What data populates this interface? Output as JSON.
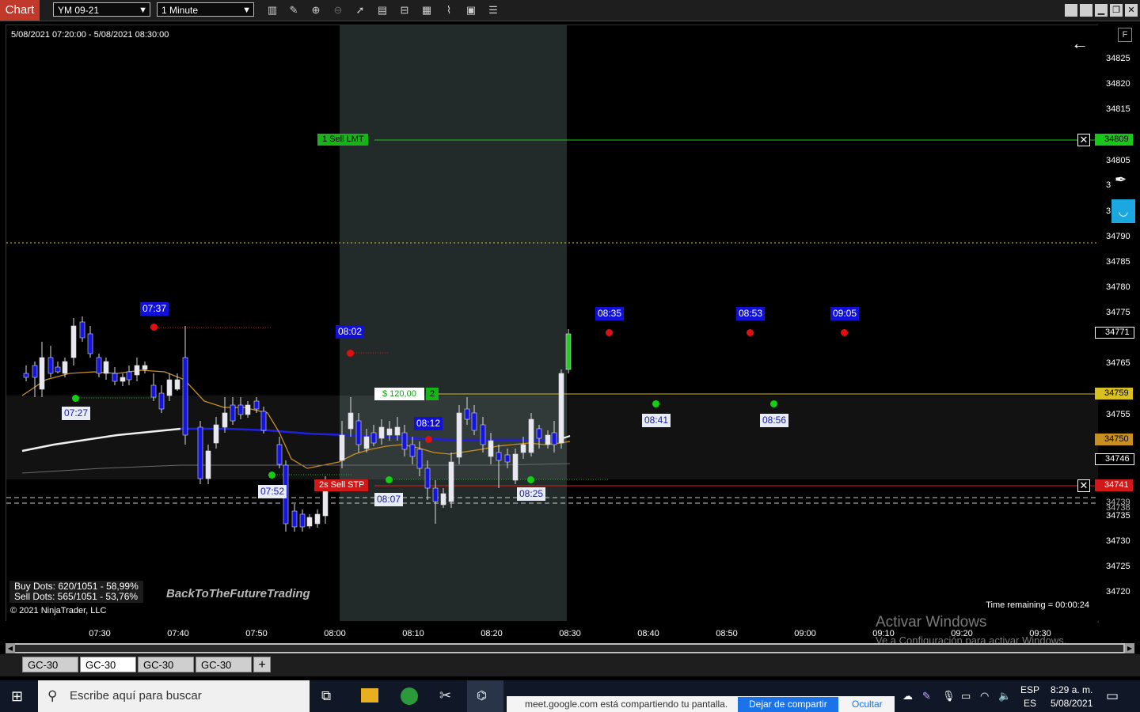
{
  "toolbar": {
    "title": "Chart",
    "instrument": "YM 09-21",
    "interval": "1 Minute"
  },
  "chart": {
    "date_range": "5/08/2021 07:20:00 - 5/08/2021 08:30:00",
    "y_ticks": [
      "34825",
      "34820",
      "34815",
      "34805",
      "34790",
      "34785",
      "34780",
      "34775",
      "34765",
      "34755",
      "34735",
      "34730",
      "34725",
      "34720"
    ],
    "x_ticks": [
      "07:30",
      "07:40",
      "07:50",
      "08:00",
      "08:10",
      "08:20",
      "08:30",
      "08:40",
      "08:50",
      "09:00",
      "09:10",
      "09:20",
      "09:30"
    ],
    "partial_ticks": {
      "a": "3",
      "b": "3"
    },
    "price_tags": {
      "sell_lmt": "34809",
      "last": "34771",
      "position": "34759",
      "vwap": "34750",
      "low_ref": "34746",
      "sell_stp": "34741",
      "dash1": "34739",
      "dash2": "34738"
    },
    "orders": {
      "sell_lmt_label": "1  Sell LMT",
      "sell_stp_label": "2s  Sell STP",
      "pnl": "$ 120,00",
      "pnl_qty": "2"
    },
    "time_tags": {
      "t0737": "07:37",
      "t0727": "07:27",
      "t0802": "08:02",
      "t0752": "07:52",
      "t0807": "08:07",
      "t0812": "08:12",
      "t0825": "08:25",
      "t0835": "08:35",
      "t0841": "08:41",
      "t0853": "08:53",
      "t0856": "08:56",
      "t0905": "09:05"
    },
    "stats": {
      "buy_dots": "Buy Dots: 620/1051 - 58,99%",
      "sell_dots": "Sell Dots: 565/1051 - 53,76%"
    },
    "watermark": "BackToTheFutureTrading",
    "copyright": "© 2021 NinjaTrader, LLC",
    "time_remaining": "Time remaining = 00:00:24",
    "colors": {
      "up": "#e8e8f0",
      "down": "#1414e0",
      "buy": "#16b416",
      "sell": "#d01818",
      "vwap": "#c89020",
      "session_shade": "#232b2a"
    }
  },
  "tabs": [
    {
      "label": "GC-30"
    },
    {
      "label": "GC-30"
    },
    {
      "label": "GC-30"
    },
    {
      "label": "GC-30"
    }
  ],
  "taskbar": {
    "search_placeholder": "Escribe aquí para buscar",
    "share_text": "meet.google.com está compartiendo tu pantalla.",
    "stop_share": "Dejar de compartir",
    "hide": "Ocultar",
    "lang": "ESP",
    "lang2": "ES",
    "time": "8:29 a. m.",
    "date": "5/08/2021"
  },
  "os": {
    "activate_title": "Activar Windows",
    "activate_sub": "Ve a Configuración para activar Windows."
  }
}
